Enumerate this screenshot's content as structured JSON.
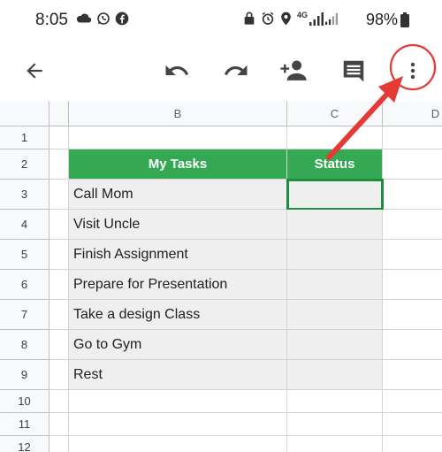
{
  "status_bar": {
    "time": "8:05",
    "network_label": "4G",
    "battery_percent": "98%"
  },
  "toolbar": {
    "icons": [
      "back-arrow-icon",
      "undo-icon",
      "redo-icon",
      "add-person-icon",
      "comment-icon",
      "more-vertical-icon"
    ]
  },
  "sheet": {
    "column_headers": [
      "B",
      "C",
      "D"
    ],
    "row_numbers": [
      "1",
      "2",
      "3",
      "4",
      "5",
      "6",
      "7",
      "8",
      "9",
      "10",
      "11",
      "12"
    ],
    "header_row": {
      "tasks": "My Tasks",
      "status": "Status"
    },
    "tasks": [
      "Call Mom",
      "Visit Uncle",
      "Finish Assignment",
      "Prepare for Presentation",
      "Take a design Class",
      "Go to Gym",
      "Rest"
    ],
    "selected_cell": "C3",
    "header_color": "#34a853"
  },
  "annotation": {
    "color": "#e53935",
    "target": "more-vertical-icon"
  }
}
